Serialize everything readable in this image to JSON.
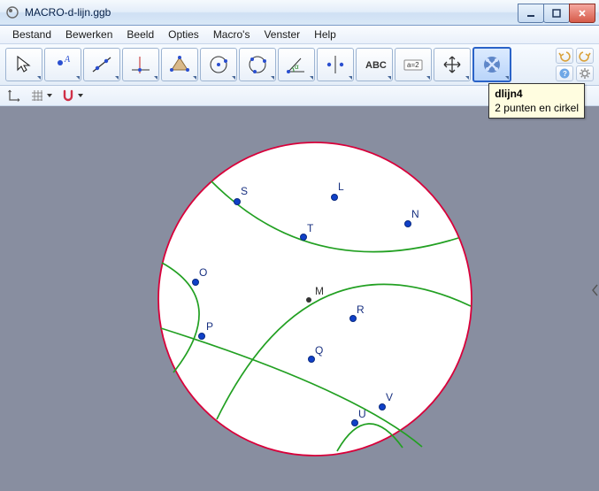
{
  "window": {
    "title": "MACRO-d-lijn.ggb"
  },
  "menu": {
    "file": "Bestand",
    "edit": "Bewerken",
    "view": "Beeld",
    "options": "Opties",
    "macros": "Macro's",
    "window": "Venster",
    "help": "Help"
  },
  "tool_text": {
    "abc": "ABC",
    "assign": "a=2"
  },
  "tooltip": {
    "title": "dlijn4",
    "desc": "2 punten en cirkel"
  },
  "points": {
    "S": "S",
    "L": "L",
    "T": "T",
    "N": "N",
    "O": "O",
    "M": "M",
    "P": "P",
    "R": "R",
    "Q": "Q",
    "U": "U",
    "V": "V"
  },
  "colors": {
    "circle": "#d8003a",
    "arc": "#22a022",
    "point_fill": "#1040c8",
    "point_stroke": "#0a2a80",
    "label": "#183080"
  }
}
